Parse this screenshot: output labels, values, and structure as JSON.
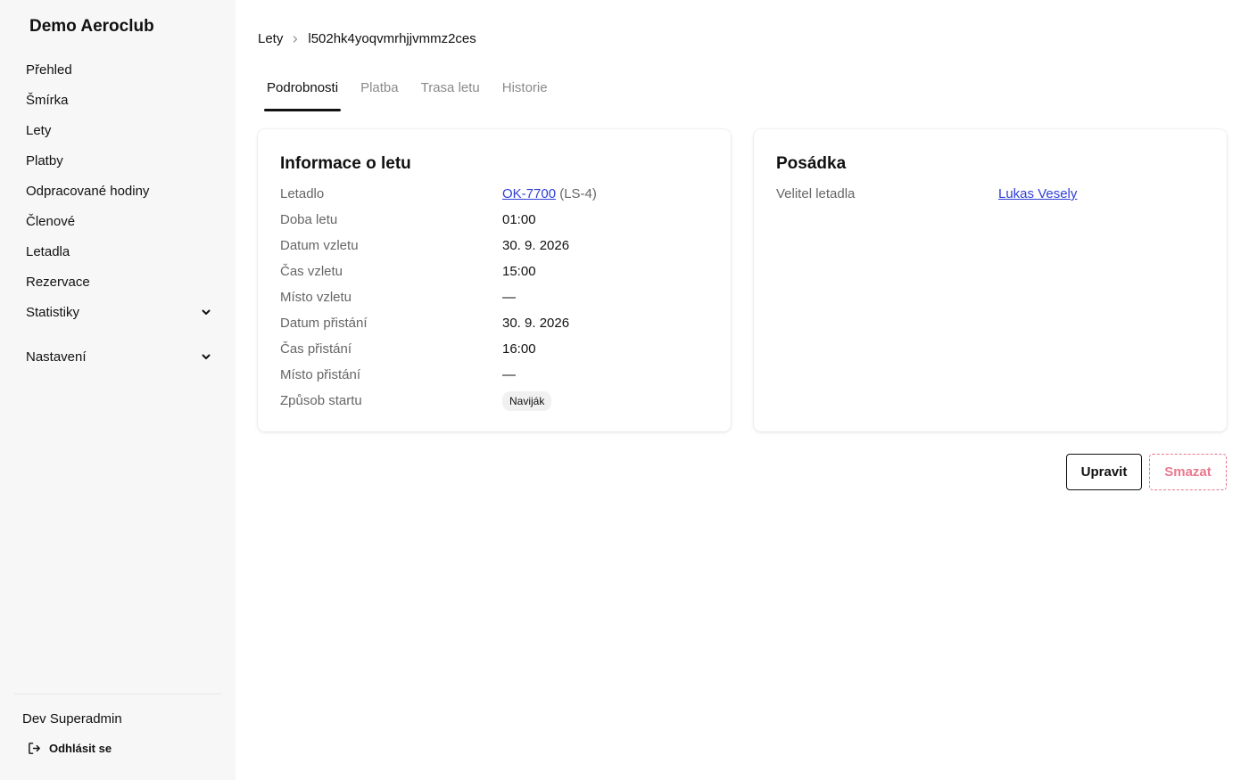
{
  "brand": "Demo Aeroclub",
  "sidebar": {
    "items": [
      {
        "label": "Přehled"
      },
      {
        "label": "Šmírka"
      },
      {
        "label": "Lety"
      },
      {
        "label": "Platby"
      },
      {
        "label": "Odpracované hodiny"
      },
      {
        "label": "Členové"
      },
      {
        "label": "Letadla"
      },
      {
        "label": "Rezervace"
      },
      {
        "label": "Statistiky"
      },
      {
        "label": "Nastavení"
      }
    ],
    "user": "Dev Superadmin",
    "logout": "Odhlásit se"
  },
  "breadcrumb": {
    "parent": "Lety",
    "current": "l502hk4yoqvmrhjjvmmz2ces"
  },
  "tabs": [
    {
      "label": "Podrobnosti",
      "active": true
    },
    {
      "label": "Platba"
    },
    {
      "label": "Trasa letu"
    },
    {
      "label": "Historie"
    }
  ],
  "flight_info": {
    "title": "Informace o letu",
    "rows": {
      "aircraft": {
        "label": "Letadlo",
        "registration": "OK-7700",
        "type": "(LS-4)"
      },
      "duration": {
        "label": "Doba letu",
        "value": "01:00"
      },
      "takeoff_date": {
        "label": "Datum vzletu",
        "value": "30. 9. 2026"
      },
      "takeoff_time": {
        "label": "Čas vzletu",
        "value": "15:00"
      },
      "takeoff_place": {
        "label": "Místo vzletu",
        "value": "—"
      },
      "landing_date": {
        "label": "Datum přistání",
        "value": "30. 9. 2026"
      },
      "landing_time": {
        "label": "Čas přistání",
        "value": "16:00"
      },
      "landing_place": {
        "label": "Místo přistání",
        "value": "—"
      },
      "launch_method": {
        "label": "Způsob startu",
        "value": "Naviják"
      }
    }
  },
  "crew": {
    "title": "Posádka",
    "pilot_label": "Velitel letadla",
    "pilot_name": "Lukas Vesely"
  },
  "actions": {
    "edit": "Upravit",
    "delete": "Smazat"
  },
  "colors": {
    "link": "#2f3fd6",
    "danger": "#e8798f",
    "sidebar_bg": "#f7f7f7"
  }
}
